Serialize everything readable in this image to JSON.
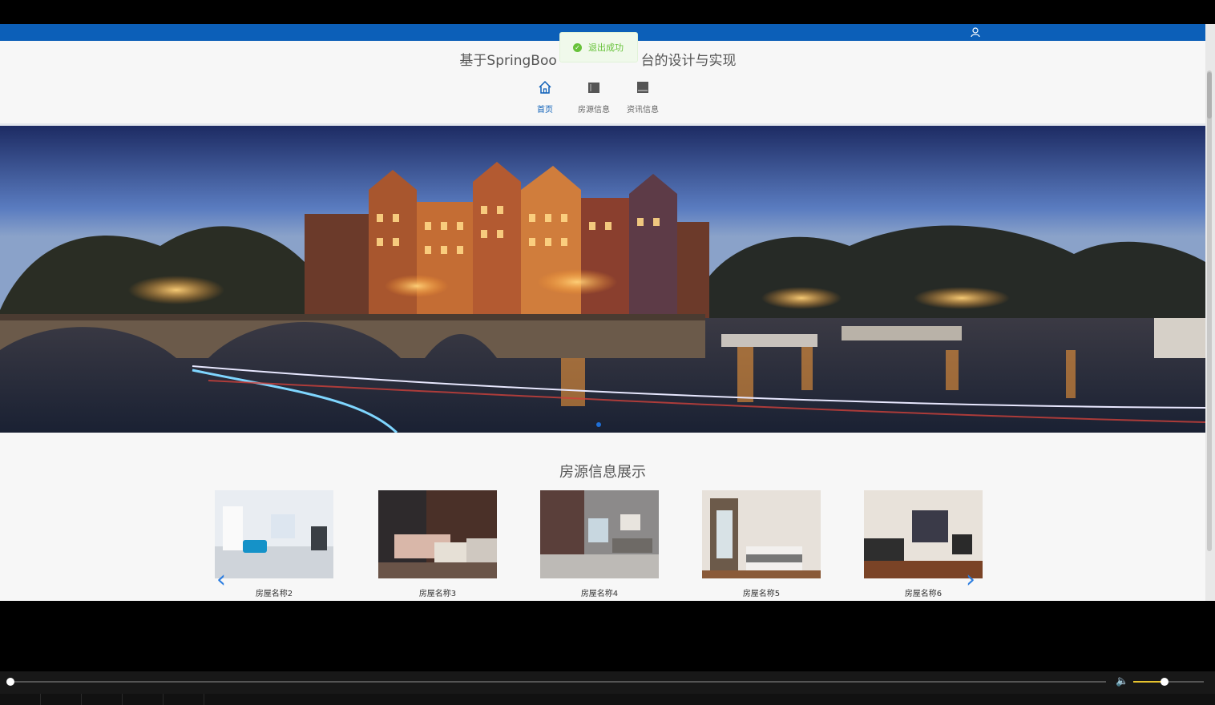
{
  "page": {
    "title": "基于SpringBoo",
    "title_suffix": "台的设计与实现",
    "toast_text": "退出成功",
    "nav": [
      {
        "label": "首页",
        "icon": "home-icon",
        "active": true
      },
      {
        "label": "房源信息",
        "icon": "house-info-icon",
        "active": false
      },
      {
        "label": "资讯信息",
        "icon": "news-icon",
        "active": false
      }
    ],
    "section_title": "房源信息展示",
    "cards": [
      {
        "name": "房屋名称2",
        "scene": "living-room-blue-sofa"
      },
      {
        "name": "房屋名称3",
        "scene": "bedroom-wood"
      },
      {
        "name": "房屋名称4",
        "scene": "living-room-grey"
      },
      {
        "name": "房屋名称5",
        "scene": "bedroom-warm"
      },
      {
        "name": "房屋名称6",
        "scene": "living-room-dark-floor"
      }
    ],
    "banner_scene": "amsterdam-canal-night",
    "colors": {
      "accent": "#0c5fb8",
      "toast": "#67c23a"
    }
  },
  "player": {
    "volume_level": 0.44
  }
}
